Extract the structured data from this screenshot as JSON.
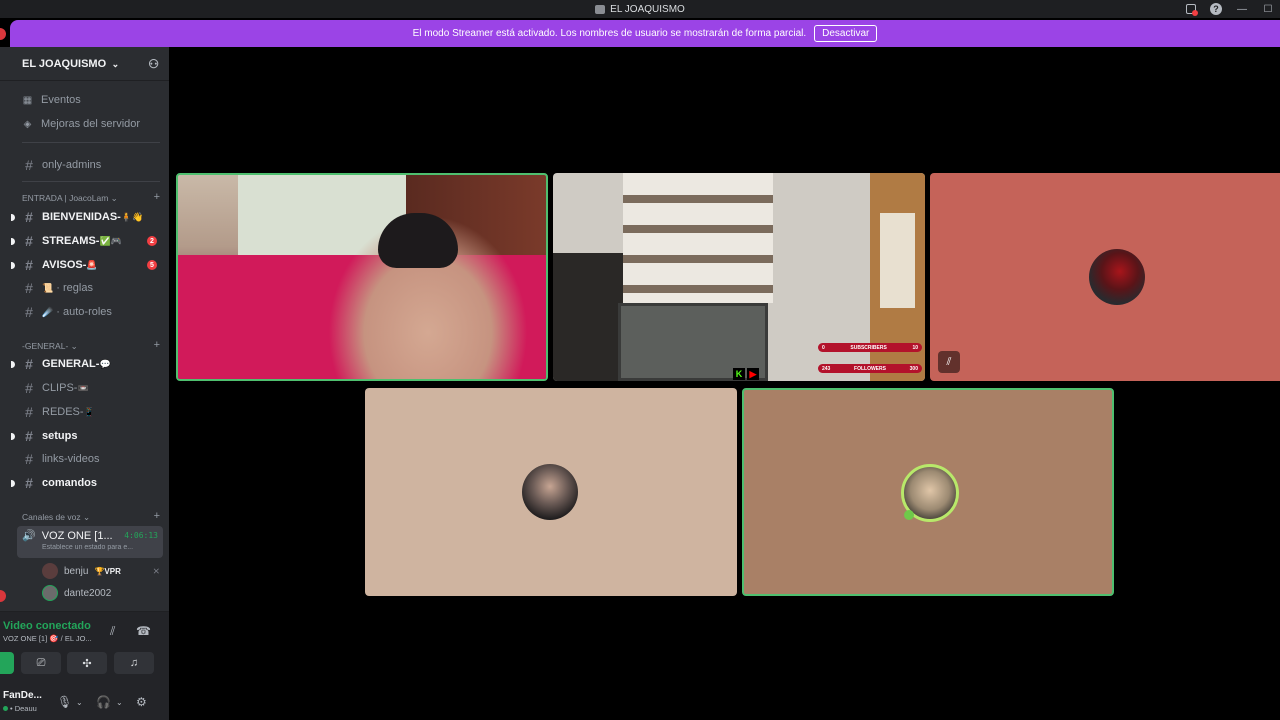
{
  "window": {
    "title": "EL JOAQUISMO"
  },
  "banner": {
    "text": "El modo Streamer está activado. Los nombres de usuario se mostrarán de forma parcial.",
    "button": "Desactivar"
  },
  "server": {
    "name": "EL JOAQUISMO"
  },
  "menu": {
    "events": "Eventos",
    "boosts": "Mejoras del servidor"
  },
  "channels": {
    "admins": "only-admins",
    "cat_entrada": "ENTRADA | JoacoLam",
    "bienvenidas": "BIENVENIDAS-",
    "streams": "STREAMS-",
    "streams_badge": "2",
    "avisos": "AVISOS-",
    "avisos_badge": "5",
    "reglas": "· reglas",
    "autoroles": "· auto-roles",
    "cat_general": "-GENERAL-",
    "general": "GENERAL-",
    "clips": "CLIPS-",
    "redes": "REDES-",
    "setups": "setups",
    "links": "links-videos",
    "comandos": "comandos",
    "cat_voz": "Canales de voz"
  },
  "voice": {
    "channel": "VOZ ONE [1...",
    "timer": "4:06:13",
    "status_hint": "Establece un estado para e...",
    "users": [
      {
        "name": "benju",
        "tag": "🏆VPR"
      },
      {
        "name": "dante2002",
        "tag": ""
      }
    ]
  },
  "voice_panel": {
    "title": "Video conectado",
    "sub": "VOZ ONE [1] 🎯 / EL JO..."
  },
  "user": {
    "name": "FanDe...",
    "status": "• Deauu"
  },
  "stream_overlay": {
    "subs_label": "SUBSCRIBERS",
    "subs_left": "0",
    "subs_right": "10",
    "followers_label": "FOLLOWERS",
    "followers_left": "243",
    "followers_right": "300"
  }
}
